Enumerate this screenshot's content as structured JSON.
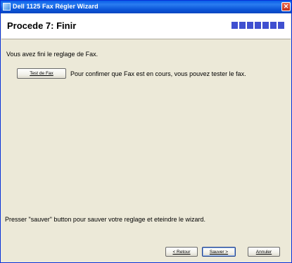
{
  "window": {
    "title": "Dell 1125 Fax Régler Wizard",
    "close_glyph": "✕"
  },
  "header": {
    "step_title": "Procede 7: Finir",
    "progress_segments": 7
  },
  "main": {
    "done_message": "Vous avez fini le reglage de Fax.",
    "test_fax_button": "Test de Fax",
    "test_fax_hint": "Pour confimer que Fax est en cours, vous pouvez tester le fax.",
    "save_instruction": "Presser \"sauver\" button pour sauver votre reglage et eteindre le wizard."
  },
  "footer": {
    "back_label": "< Retour",
    "save_label": "Sauver >",
    "cancel_label": "Annuler"
  },
  "colors": {
    "titlebar": "#0a5fe8",
    "dialog_bg": "#ece9d8",
    "progress": "#3f4fd0"
  }
}
